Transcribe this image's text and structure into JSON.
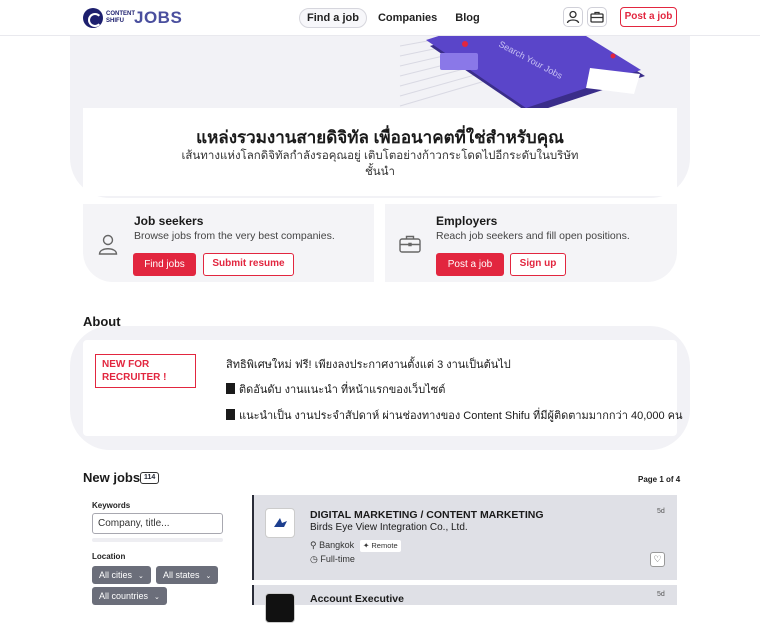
{
  "header": {
    "logo_small": "CONTENT SHIFU",
    "logo_big": "JOBS",
    "nav": [
      {
        "label": "Find a job",
        "active": true
      },
      {
        "label": "Companies",
        "active": false
      },
      {
        "label": "Blog",
        "active": false
      }
    ],
    "post_job_label": "Post a job",
    "accent_color": "#e2263f"
  },
  "hero": {
    "illustration_text": "Search Your Jobs",
    "title": "แหล่งรวมงานสายดิจิทัล เพื่ออนาคตที่ใช่สำหรับคุณ",
    "subtitle": "เส้นทางแห่งโลกดิจิทัลกำลังรอคุณอยู่ เติบโตอย่างก้าวกระโดดไปอีกระดับในบริษัทชั้นนำ"
  },
  "audiences": [
    {
      "icon": "person-icon",
      "title": "Job seekers",
      "desc": "Browse jobs from the very best companies.",
      "primary": "Find jobs",
      "secondary": "Submit resume"
    },
    {
      "icon": "briefcase-icon",
      "title": "Employers",
      "desc": "Reach job seekers and fill open positions.",
      "primary": "Post a job",
      "secondary": "Sign up"
    }
  ],
  "about": {
    "heading": "About",
    "badge": "NEW FOR RECRUITER !",
    "lines": [
      "สิทธิพิเศษใหม่ ฟรี! เพียงลงประกาศงานตั้งแต่ 3 งานเป็นต้นไป",
      "ติดอันดับ งานแนะนำ ที่หน้าแรกของเว็บไซต์",
      "แนะนำเป็น งานประจำสัปดาห์ ผ่านช่องทางของ Content Shifu ที่มีผู้ติดตามมากกว่า 40,000 คน"
    ]
  },
  "new_jobs": {
    "heading": "New jobs",
    "count": "114",
    "page_info": "Page 1 of 4",
    "filters": {
      "keywords_label": "Keywords",
      "keywords_placeholder": "Company, title...",
      "location_label": "Location",
      "cities": "All cities",
      "states": "All states",
      "countries": "All countries"
    },
    "jobs": [
      {
        "title": "DIGITAL MARKETING / CONTENT MARKETING",
        "company": "Birds Eye View Integration Co., Ltd.",
        "location": "Bangkok",
        "remote": "Remote",
        "type": "Full-time",
        "age": "5d"
      },
      {
        "title": "Account Executive",
        "age": "5d"
      }
    ]
  }
}
